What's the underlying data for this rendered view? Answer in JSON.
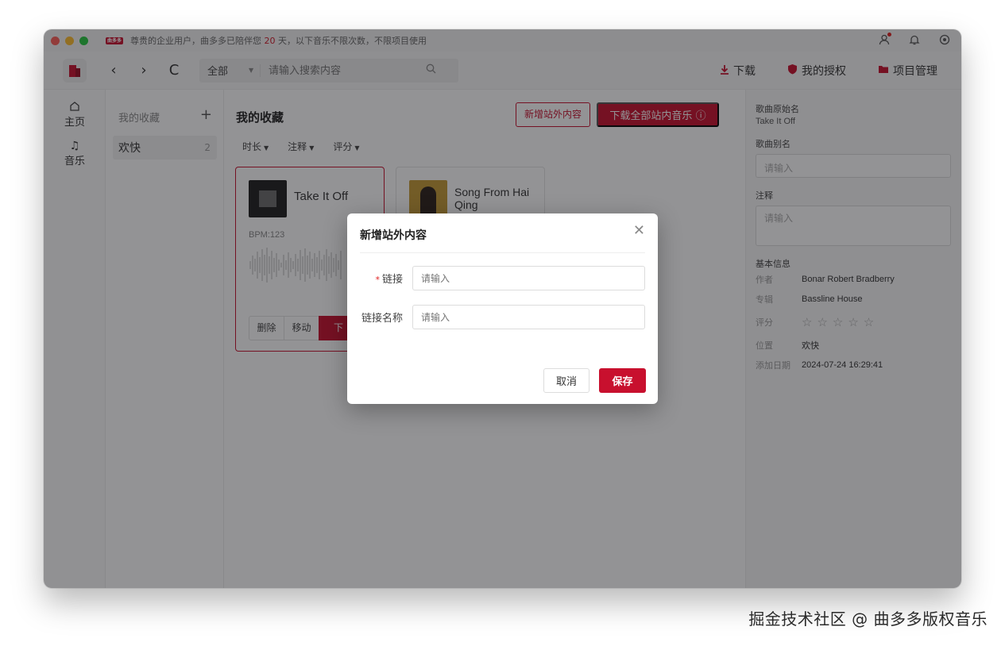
{
  "titlebar": {
    "brand_badge": "曲多多",
    "notice_prefix": "尊贵的企业用户，曲多多已陪伴您",
    "notice_days": "20",
    "notice_suffix": "天，以下音乐不限次数，不限项目使用"
  },
  "toolbar": {
    "back": "‹",
    "forward": "›",
    "refresh": "C",
    "scope": "全部",
    "search_placeholder": "请输入搜索内容",
    "download": "下载",
    "my_license": "我的授权",
    "project_mgmt": "项目管理"
  },
  "rail": {
    "home": "主页",
    "music": "音乐"
  },
  "list_pane": {
    "header": "我的收藏",
    "items": [
      {
        "label": "欢快",
        "count": "2"
      }
    ]
  },
  "main": {
    "title": "我的收藏",
    "add_external_btn": "新增站外内容",
    "download_all_btn": "下载全部站内音乐",
    "filters": [
      "时长",
      "注释",
      "评分"
    ],
    "cards": [
      {
        "title": "Take It Off",
        "bpm": "BPM:123",
        "actions": [
          "删除",
          "移动",
          "下"
        ]
      },
      {
        "title": "Song From Hai Qing"
      }
    ]
  },
  "detail": {
    "orig_name_label": "歌曲原始名",
    "orig_name": "Take It Off",
    "alias_label": "歌曲别名",
    "alias_placeholder": "请输入",
    "note_label": "注释",
    "note_placeholder": "请输入",
    "basic_info_label": "基本信息",
    "author_label": "作者",
    "author": "Bonar Robert Bradberry",
    "album_label": "专辑",
    "album": "Bassline House",
    "rating_label": "评分",
    "rating_stars": "☆☆☆☆☆",
    "location_label": "位置",
    "location": "欢快",
    "added_label": "添加日期",
    "added": "2024-07-24 16:29:41"
  },
  "modal": {
    "title": "新增站外内容",
    "link_label": "链接",
    "link_placeholder": "请输入",
    "link_name_label": "链接名称",
    "link_name_placeholder": "请输入",
    "cancel": "取消",
    "save": "保存"
  },
  "watermark": "掘金技术社区 @ 曲多多版权音乐",
  "colors": {
    "accent": "#c8102e"
  }
}
